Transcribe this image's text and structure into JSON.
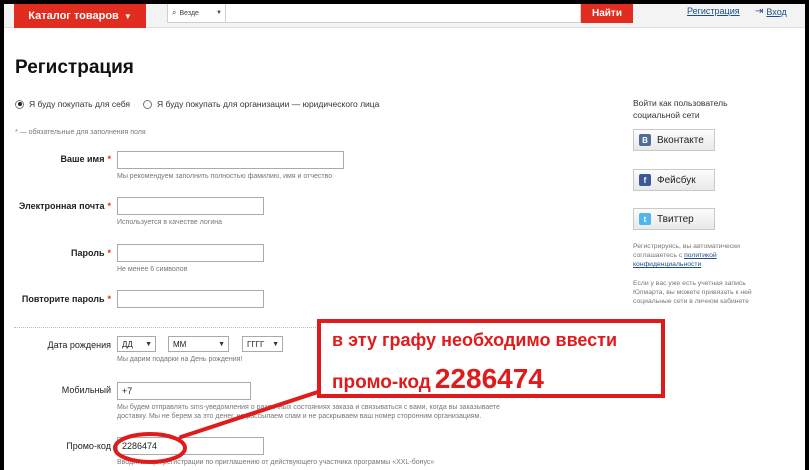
{
  "header": {
    "catalog_label": "Каталог товаров",
    "search_scope": "Везде",
    "search_value": "",
    "search_button": "Найти",
    "register_link": "Регистрация",
    "login_link": "Вход"
  },
  "page": {
    "title": "Регистрация",
    "buyer_types": [
      {
        "label": "Я буду покупать для себя",
        "selected": true
      },
      {
        "label": "Я буду покупать для организации — юридического лица",
        "selected": false
      }
    ],
    "required_note": "* — обязательные для заполнения поля"
  },
  "form": {
    "name": {
      "label": "Ваше имя",
      "value": "",
      "hint": "Мы рекомендуем заполнить полностью фамилию, имя и отчество"
    },
    "email": {
      "label": "Электронная почта",
      "value": "",
      "hint": "Используется в качестве логина"
    },
    "password": {
      "label": "Пароль",
      "value": "",
      "hint": "Не менее 6 символов"
    },
    "password_repeat": {
      "label": "Повторите пароль",
      "value": ""
    },
    "birthdate": {
      "label": "Дата рождения",
      "day": "ДД",
      "month": "ММ",
      "year": "ГГГГ",
      "hint": "Мы дарим подарки на День рождения!"
    },
    "mobile": {
      "label": "Мобильный",
      "value": "+7",
      "hint_line1": "Мы будем отправлять sms-уведомления о различных состояниях заказа и связываться с вами, когда вы заказываете",
      "hint_line2": "доставку. Мы не берем за это денег, не рассылаем спам и не раскрываем ваш номер сторонним организациям."
    },
    "promo": {
      "label": "Промо-код",
      "value": "2286474",
      "hint": "Вводится при регистрации по приглашению от действующего участника программы «XXL-бонус»"
    }
  },
  "sidebar": {
    "title": "Войти как пользователь социальной сети",
    "buttons": [
      {
        "label": "Вконтакте",
        "icon": "vk-icon"
      },
      {
        "label": "Фейсбук",
        "icon": "facebook-icon"
      },
      {
        "label": "Твиттер",
        "icon": "twitter-icon"
      }
    ],
    "agree_text": "Регистрируясь, вы автоматически соглашаетесь",
    "agree_prefix": "с",
    "policy_link": "политикой конфиденциальности",
    "existing_text": "Если у вас уже есть учетная запись Юлмарта, вы можете привязать к ней социальные сети в личном кабинете"
  },
  "annotation": {
    "line1": "в эту графу необходимо ввести",
    "line2": "промо-код",
    "code": "2286474"
  },
  "colors": {
    "accent": "#e12d20",
    "link": "#1a4f8a",
    "annotation": "#e01b1b"
  }
}
